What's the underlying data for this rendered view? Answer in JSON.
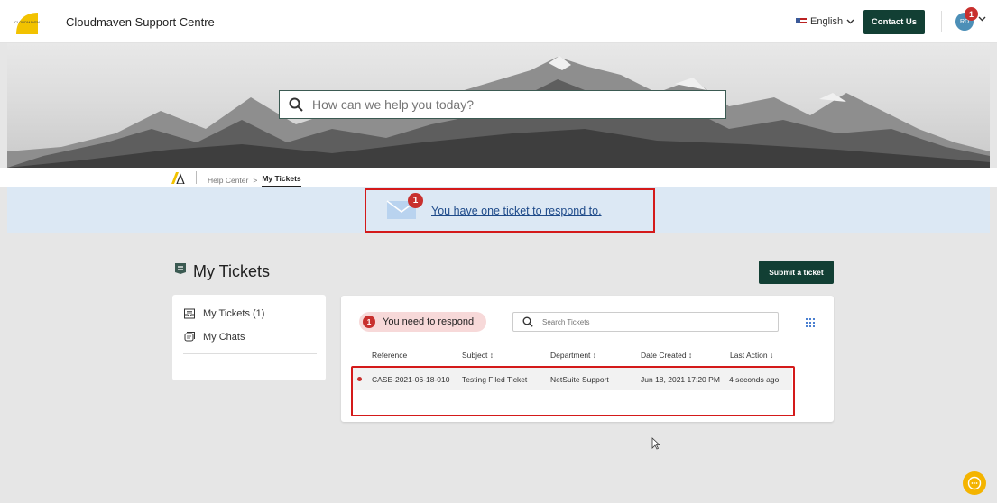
{
  "header": {
    "logo_text": "CLOUDMAVEN",
    "site_title": "Cloudmaven Support Centre",
    "language": "English",
    "contact_label": "Contact Us",
    "avatar_initials": "RD",
    "avatar_badge": "1"
  },
  "hero": {
    "search_placeholder": "How can we help you today?"
  },
  "breadcrumb": {
    "home": "Help Center",
    "separator": ">",
    "current": "My Tickets"
  },
  "notice": {
    "badge": "1",
    "text": "You have one ticket to respond to."
  },
  "tickets": {
    "title": "My Tickets",
    "submit_label": "Submit a ticket",
    "sidebar": [
      {
        "label": "My Tickets (1)"
      },
      {
        "label": "My Chats"
      }
    ],
    "filter": {
      "badge": "1",
      "label": "You need to respond"
    },
    "search_placeholder": "Search Tickets",
    "columns": [
      "Reference",
      "Subject ↕",
      "Department ↕",
      "Date Created ↕",
      "Last Action ↓"
    ],
    "rows": [
      {
        "reference": "CASE-2021-06-18-010",
        "subject": "Testing Filed Ticket",
        "department": "NetSuite Support",
        "date_created": "Jun 18, 2021 17:20 PM",
        "last_action": "4 seconds ago"
      }
    ]
  },
  "colors": {
    "brand_dark": "#123f34",
    "alert_red": "#c8302e",
    "notice_bg": "#dce8f4",
    "link_blue": "#1f4b8a",
    "chat_yellow": "#f4b400"
  }
}
